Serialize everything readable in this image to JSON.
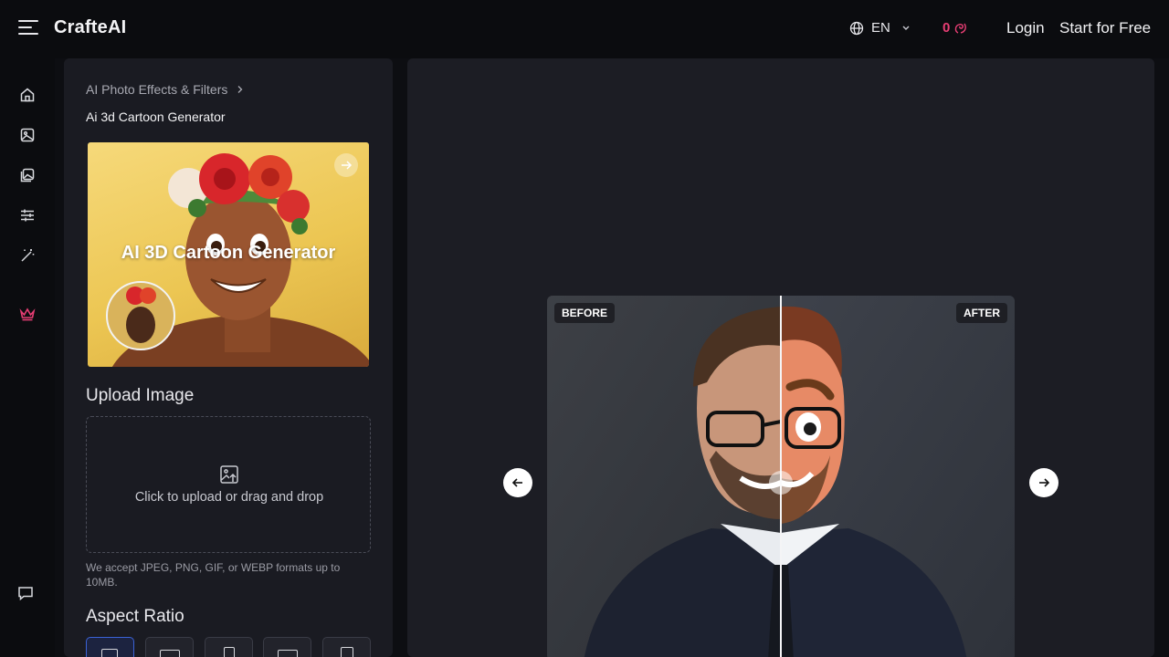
{
  "header": {
    "brand": "CrafteAI",
    "language": "EN",
    "credits": "0",
    "login_label": "Login",
    "start_label": "Start for Free"
  },
  "sidebar": {
    "items": [
      {
        "icon": "home-icon"
      },
      {
        "icon": "image-icon"
      },
      {
        "icon": "gallery-icon"
      },
      {
        "icon": "sliders-icon"
      },
      {
        "icon": "magic-wand-icon"
      },
      {
        "icon": "crown-icon"
      }
    ],
    "chat_icon": "chat-icon"
  },
  "panel": {
    "breadcrumb": "AI Photo Effects & Filters",
    "subtitle": "Ai 3d Cartoon Generator",
    "card_title": "AI 3D Cartoon Generator",
    "upload_title": "Upload Image",
    "upload_text": "Click to upload or drag and drop",
    "upload_hint": "We accept JPEG, PNG, GIF, or WEBP formats up to 10MB.",
    "aspect_title": "Aspect Ratio"
  },
  "preview": {
    "before_label": "BEFORE",
    "after_label": "AFTER"
  },
  "colors": {
    "accent_pink": "#e83e74",
    "selected_blue": "#3b63d6"
  }
}
